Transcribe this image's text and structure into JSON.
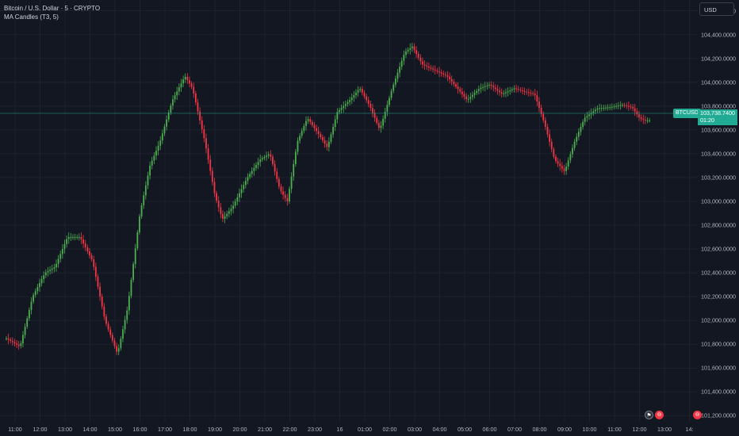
{
  "legend": {
    "symbol_line": "Bitcoin / U.S. Dollar · 5 · CRYPTO",
    "indicator_line": "MA Candles (T3, 5)"
  },
  "currency": "USD",
  "last_price": {
    "symbol": "BTCUSD",
    "value": "103,738.7400",
    "countdown": "01:20",
    "price_num": 103738.74,
    "color": "#22ab94"
  },
  "colors": {
    "up": "#4caf50",
    "down": "#f23645",
    "background": "#131722",
    "grid": "#1e222d"
  },
  "events": {
    "icon_names": [
      "flag-icon",
      "economic-event-icon",
      "economic-event-icon"
    ]
  },
  "chart_data": {
    "type": "candlestick",
    "title": "Bitcoin / U.S. Dollar · 5 · CRYPTO",
    "indicator": "MA Candles (T3, 5)",
    "y_ticks": [
      101200000,
      101400000,
      101600000,
      101800000,
      102000000,
      102200000,
      102400000,
      102600000,
      102800000,
      103000000,
      103200000,
      103400000,
      103600000,
      103800000,
      104000000,
      104200000,
      104400000,
      104600000
    ],
    "y_tick_labels": [
      "101,200.0000",
      "101,400.0000",
      "101,600.0000",
      "101,800.0000",
      "102,000.0000",
      "102,200.0000",
      "102,400.0000",
      "102,600.0000",
      "102,800.0000",
      "103,000.0000",
      "103,200.0000",
      "103,400.0000",
      "103,600.0000",
      "103,800.0000",
      "104,000.0000",
      "104,200.0000",
      "104,400.0000",
      "104,600.0000"
    ],
    "ylim": [
      101150,
      104690
    ],
    "x_tick_labels": [
      "11:00",
      "12:00",
      "13:00",
      "14:00",
      "15:00",
      "16:00",
      "17:00",
      "18:00",
      "19:00",
      "20:00",
      "21:00",
      "22:00",
      "23:00",
      "16",
      "01:00",
      "02:00",
      "03:00",
      "04:00",
      "05:00",
      "06:00",
      "07:00",
      "08:00",
      "09:00",
      "10:00",
      "11:00",
      "12:00",
      "13:00",
      "14:"
    ],
    "x_tick_hours": [
      0,
      1,
      2,
      3,
      4,
      5,
      6,
      7,
      8,
      9,
      10,
      11,
      12,
      13,
      14,
      15,
      16,
      17,
      18,
      19,
      20,
      21,
      22,
      23,
      24,
      25,
      26,
      27
    ],
    "x_start_hour": -0.35,
    "close_path": [
      [
        -0.35,
        101850
      ],
      [
        0.2,
        101780
      ],
      [
        0.7,
        102200
      ],
      [
        1.2,
        102400
      ],
      [
        1.6,
        102450
      ],
      [
        2.1,
        102700
      ],
      [
        2.6,
        102700
      ],
      [
        3.1,
        102500
      ],
      [
        3.6,
        102000
      ],
      [
        4.1,
        101720
      ],
      [
        4.5,
        102100
      ],
      [
        5.0,
        102900
      ],
      [
        5.4,
        103300
      ],
      [
        5.8,
        103500
      ],
      [
        6.3,
        103850
      ],
      [
        6.8,
        104050
      ],
      [
        7.1,
        103950
      ],
      [
        7.6,
        103500
      ],
      [
        8.0,
        103050
      ],
      [
        8.3,
        102850
      ],
      [
        8.7,
        102950
      ],
      [
        9.3,
        103200
      ],
      [
        9.8,
        103350
      ],
      [
        10.2,
        103400
      ],
      [
        10.6,
        103100
      ],
      [
        10.9,
        103000
      ],
      [
        11.3,
        103500
      ],
      [
        11.7,
        103700
      ],
      [
        12.2,
        103550
      ],
      [
        12.5,
        103450
      ],
      [
        12.9,
        103750
      ],
      [
        13.4,
        103850
      ],
      [
        13.8,
        103950
      ],
      [
        14.2,
        103800
      ],
      [
        14.6,
        103600
      ],
      [
        15.1,
        103950
      ],
      [
        15.6,
        104250
      ],
      [
        15.9,
        104300
      ],
      [
        16.3,
        104150
      ],
      [
        16.8,
        104100
      ],
      [
        17.3,
        104050
      ],
      [
        17.7,
        103950
      ],
      [
        18.1,
        103850
      ],
      [
        18.6,
        103950
      ],
      [
        19.0,
        103980
      ],
      [
        19.5,
        103900
      ],
      [
        20.0,
        103950
      ],
      [
        20.4,
        103920
      ],
      [
        20.8,
        103900
      ],
      [
        21.2,
        103650
      ],
      [
        21.6,
        103350
      ],
      [
        22.0,
        103250
      ],
      [
        22.4,
        103500
      ],
      [
        22.8,
        103700
      ],
      [
        23.3,
        103780
      ],
      [
        23.8,
        103790
      ],
      [
        24.3,
        103810
      ],
      [
        24.7,
        103790
      ],
      [
        25.0,
        103700
      ],
      [
        25.2,
        103680
      ],
      [
        25.4,
        103680
      ]
    ]
  }
}
